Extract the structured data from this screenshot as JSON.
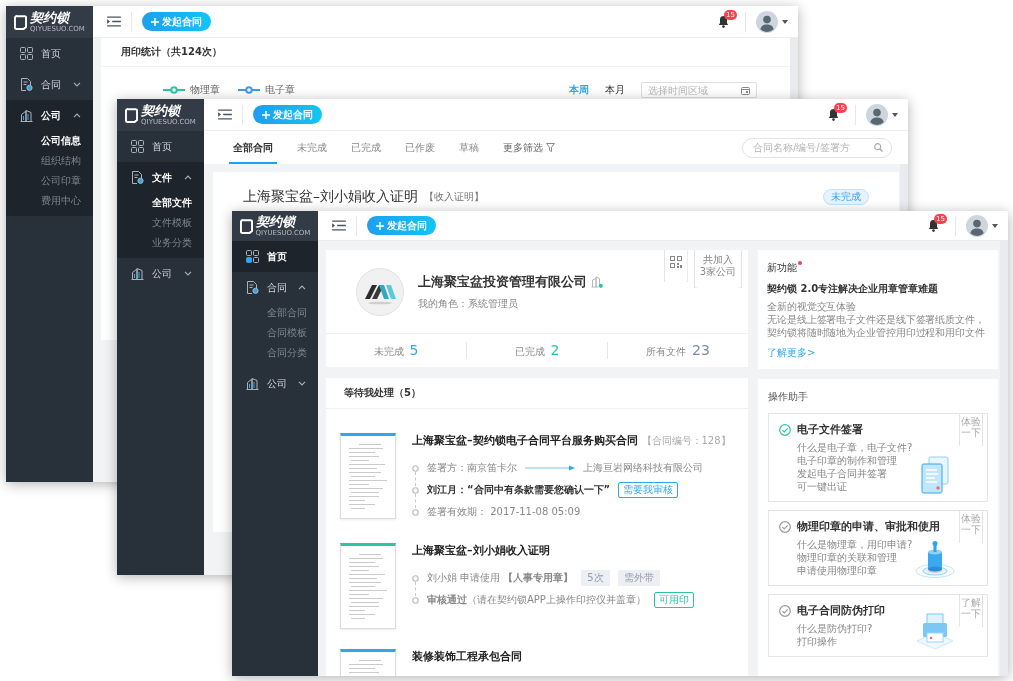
{
  "back_window": {
    "logo": {
      "name": "契约锁",
      "domain": "QIYUESUO.COM"
    },
    "sidebar": [
      {
        "kind": "page",
        "label": "首页",
        "selected": false
      },
      {
        "kind": "group",
        "label": "合同",
        "selected": false,
        "expanded": false
      },
      {
        "kind": "group",
        "label": "公司",
        "selected": true,
        "expanded": true,
        "children": [
          {
            "label": "公司信息",
            "selected": true
          },
          {
            "label": "组织结构",
            "selected": false
          },
          {
            "label": "公司印章",
            "selected": false
          },
          {
            "label": "费用中心",
            "selected": false
          }
        ]
      }
    ],
    "topbar": {
      "new_button": "发起合同",
      "notifications": "15"
    },
    "title": "用印统计（共124次）",
    "legend": [
      {
        "label": "物理章",
        "color": "#2cc5a4"
      },
      {
        "label": "电子章",
        "color": "#3d9be9"
      }
    ],
    "periods": [
      {
        "label": "本周",
        "selected": true
      },
      {
        "label": "本月",
        "selected": false
      }
    ],
    "date_range": {
      "placeholder": "选择时间区域"
    }
  },
  "middle_window": {
    "logo": {
      "name": "契约锁",
      "domain": "QIYUESUO.COM"
    },
    "sidebar": [
      {
        "kind": "page",
        "label": "首页",
        "selected": false
      },
      {
        "kind": "group",
        "label": "文件",
        "selected": true,
        "expanded": true,
        "children": [
          {
            "label": "全部文件",
            "selected": true
          },
          {
            "label": "文件模板",
            "selected": false
          },
          {
            "label": "业务分类",
            "selected": false
          }
        ]
      },
      {
        "kind": "group",
        "label": "公司",
        "selected": false,
        "expanded": false
      }
    ],
    "topbar": {
      "new_button": "发起合同",
      "notifications": "15"
    },
    "tabs": [
      {
        "label": "全部合同",
        "selected": true
      },
      {
        "label": "未完成",
        "selected": false
      },
      {
        "label": "已完成",
        "selected": false
      },
      {
        "label": "已作废",
        "selected": false
      },
      {
        "label": "草稿",
        "selected": false
      }
    ],
    "filter": "更多筛选",
    "search": {
      "placeholder": "合同名称/编号/签署方"
    },
    "document": {
      "title": "上海聚宝盆–刘小娟收入证明",
      "category": "【收入证明】",
      "status": "未完成"
    }
  },
  "front_window": {
    "logo": {
      "name": "契约锁",
      "domain": "QIYUESUO.COM"
    },
    "sidebar": [
      {
        "kind": "page",
        "label": "首页",
        "selected": true
      },
      {
        "kind": "group",
        "label": "合同",
        "selected": false,
        "expanded": true,
        "children": [
          {
            "label": "全部合同",
            "selected": false
          },
          {
            "label": "合同模板",
            "selected": false
          },
          {
            "label": "合同分类",
            "selected": false
          }
        ]
      },
      {
        "kind": "group",
        "label": "公司",
        "selected": false,
        "expanded": false
      }
    ],
    "topbar": {
      "new_button": "发起合同",
      "notifications": "15"
    },
    "company": {
      "name": "上海聚宝盆投资管理有限公司",
      "role": "我的角色：系统管理员",
      "joined": "共加入 3家公司"
    },
    "stats": [
      {
        "label": "未完成",
        "value": "5",
        "color": "#2fa8ea"
      },
      {
        "label": "已完成",
        "value": "2",
        "color": "#2cc5a4"
      },
      {
        "label": "所有文件",
        "value": "23",
        "color": "#7d8ba6"
      }
    ],
    "pending": {
      "title": "等待我处理（5）",
      "items": [
        {
          "title": "上海聚宝盆–契约锁电子合同平台服务购买合同",
          "number": "【合同编号：128】",
          "color": "#2fa8ea",
          "steps": [
            {
              "text": "签署方：南京笛卡尔",
              "to": "上海亘岩网络科技有限公司",
              "emphasized": false
            },
            {
              "text": "刘江月：“合同中有条款需要您确认一下”",
              "emphasized": true,
              "tag": {
                "label": "需要我审核",
                "color": "#2fa8ea"
              }
            },
            {
              "text": "签署有效期： 2017-11-08 05:09",
              "emphasized": false
            }
          ]
        },
        {
          "title": "上海聚宝盆–刘小娟收入证明",
          "color": "#2cc5a4",
          "steps": [
            {
              "text": "刘小娟 申请使用 **【人事专用章】**",
              "emphasized": false,
              "chips": [
                "5次",
                "需外带"
              ]
            },
            {
              "text": "**审核通过**（请在契约锁APP上操作印控仪并盖章）",
              "emphasized": false,
              "tag": {
                "label": "可用印",
                "color": "#2cc5a4"
              }
            }
          ]
        },
        {
          "title": "装修装饰工程承包合同",
          "color": "#2fa8ea"
        }
      ]
    },
    "news": {
      "title": "新功能",
      "unread": true,
      "headline": "契约锁 2.0专注解决企业用章管章难题",
      "lines": [
        "全新的视觉交互体验",
        "无论是线上签署电子文件还是线下签署纸质文件，",
        "契约锁将随时随地为企业管控用印过程和用印文件"
      ],
      "link": "了解更多>"
    },
    "assistant": {
      "title": "操作助手",
      "guides": [
        {
          "title": "电子文件签署",
          "completed": true,
          "ribbon": "体验一下",
          "points": [
            "什么是电子章，电子文件?",
            "电子印章的制作和管理",
            "发起电子合同并签署",
            "可一键出证"
          ]
        },
        {
          "title": "物理印章的申请、审批和使用",
          "completed": false,
          "ribbon": "体验一下",
          "points": [
            "什么是物理章，用印申请?",
            "物理印章的关联和管理",
            "申请使用物理印章"
          ]
        },
        {
          "title": "电子合同防伪打印",
          "completed": false,
          "ribbon": "了解一下",
          "points": [
            "什么是防伪打印?",
            "打印操作"
          ]
        }
      ]
    }
  }
}
